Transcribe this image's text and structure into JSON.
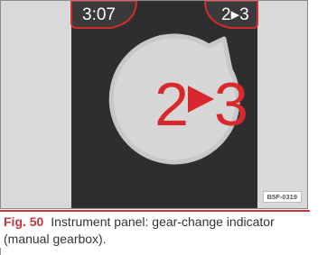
{
  "figure": {
    "clock": "3:07",
    "gear_small": "2▸3",
    "zoom_from": "2",
    "zoom_to": "3",
    "ref_code": "B5F-0319",
    "colors": {
      "background": "#d9d9d9",
      "display": "#2e2e2e",
      "accent": "#d8282e",
      "bezel": "#444444"
    },
    "icons": {
      "arrow": "right-triangle-icon"
    }
  },
  "caption": {
    "label": "Fig. 50",
    "text": "Instrument panel: gear-change indicator (manual gearbox)."
  }
}
